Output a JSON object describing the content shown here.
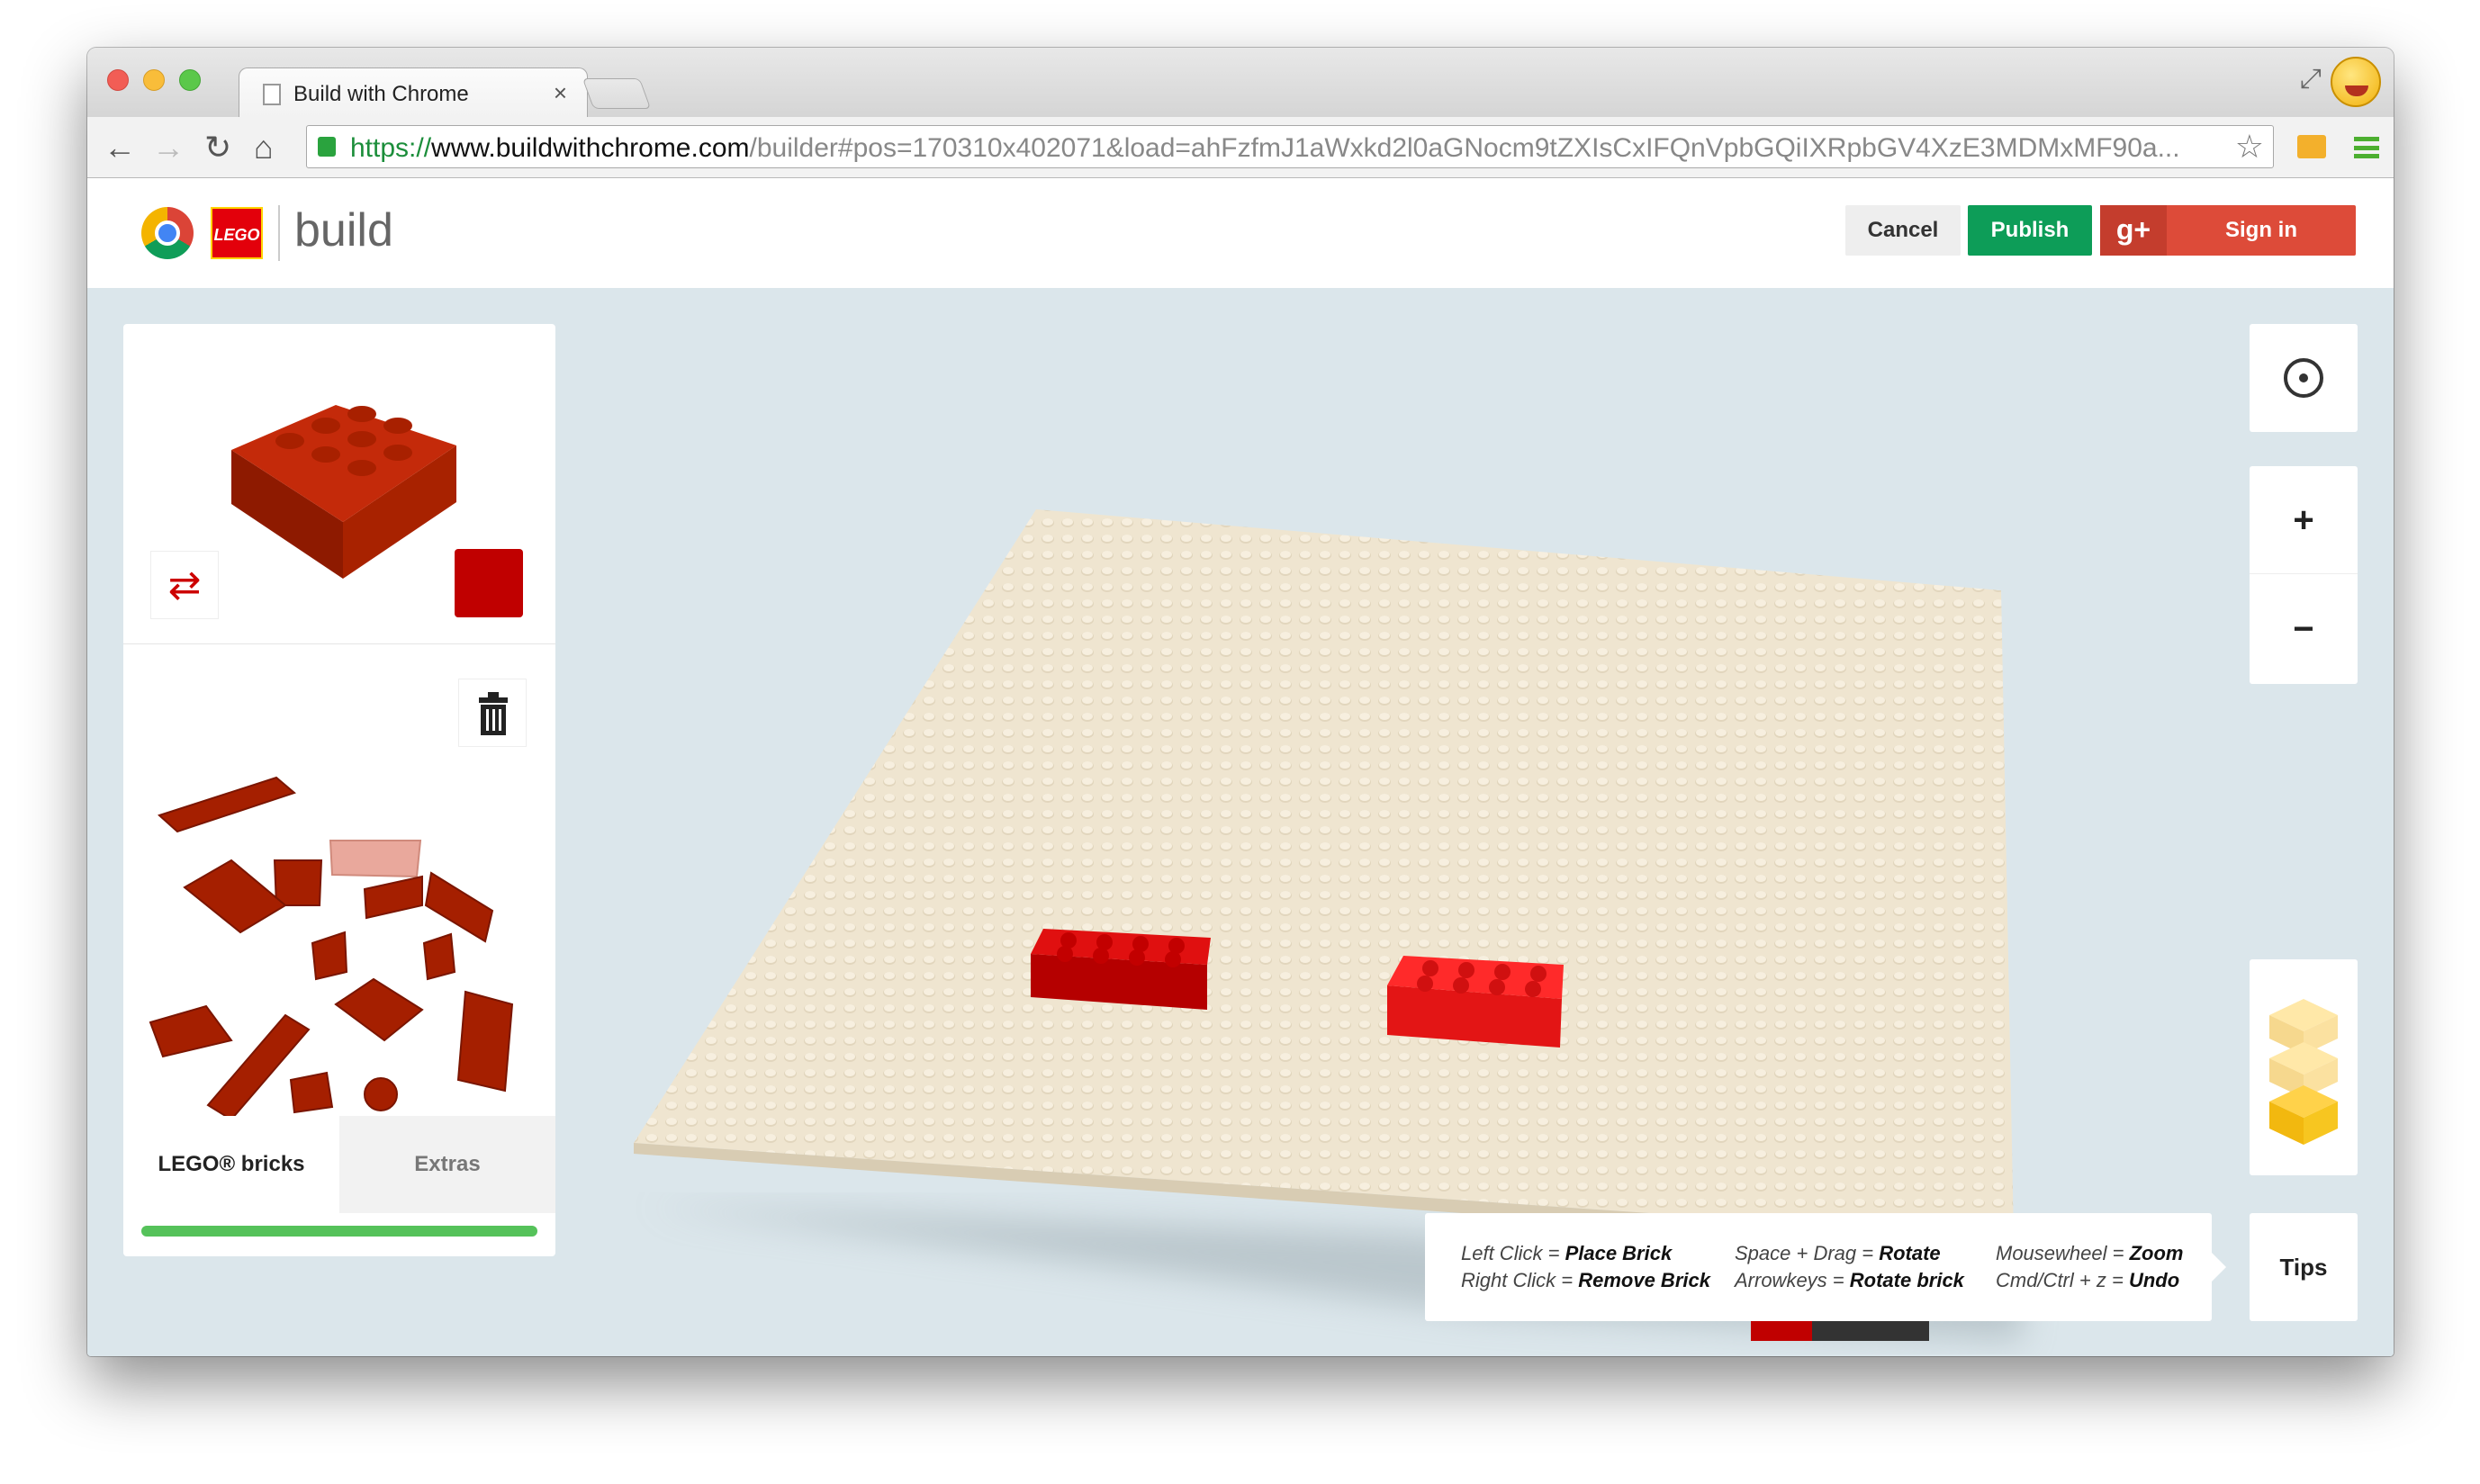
{
  "browser": {
    "tab_title": "Build with Chrome",
    "tab_close": "×",
    "url_scheme": "https://",
    "url_host": "www.buildwithchrome.com",
    "url_path": "/builder#pos=170310x402071&load=ahFzfmJ1aWxkd2l0aGNocm9tZXIsCxIFQnVpbGQiIXRpbGV4XzE3MDMxMF90a...",
    "back_icon": "←",
    "forward_icon": "→",
    "reload_icon": "↻",
    "home_icon": "⌂",
    "star_icon": "☆",
    "fullscreen_icon": "⤢"
  },
  "header": {
    "brand_lego": "LEGO",
    "title": "build",
    "cancel_label": "Cancel",
    "publish_label": "Publish",
    "gplus_label": "g+",
    "signin_label": "Sign in"
  },
  "panel": {
    "rotate_icon": "⇄",
    "selected_color": "#c00000",
    "tab_lego": "LEGO® bricks",
    "tab_extras": "Extras",
    "progress": 1.0
  },
  "controls": {
    "zoom_in": "+",
    "zoom_out": "−",
    "tips_label": "Tips"
  },
  "tips": {
    "left_click_key": "Left Click",
    "left_click_action": "Place Brick",
    "right_click_key": "Right Click",
    "right_click_action": "Remove Brick",
    "space_drag_key": "Space + Drag",
    "space_drag_action": "Rotate",
    "arrowkeys_key": "Arrowkeys",
    "arrowkeys_action": "Rotate brick",
    "mousewheel_key": "Mousewheel",
    "mousewheel_action": "Zoom",
    "undo_key": "Cmd/Ctrl + z",
    "undo_action": "Undo"
  },
  "colors": {
    "brick_red": "#c00000",
    "baseplate": "#efe4cf",
    "publish_green": "#0d9d58",
    "signin_red": "#dd4b39",
    "progress_green": "#55c25a"
  }
}
